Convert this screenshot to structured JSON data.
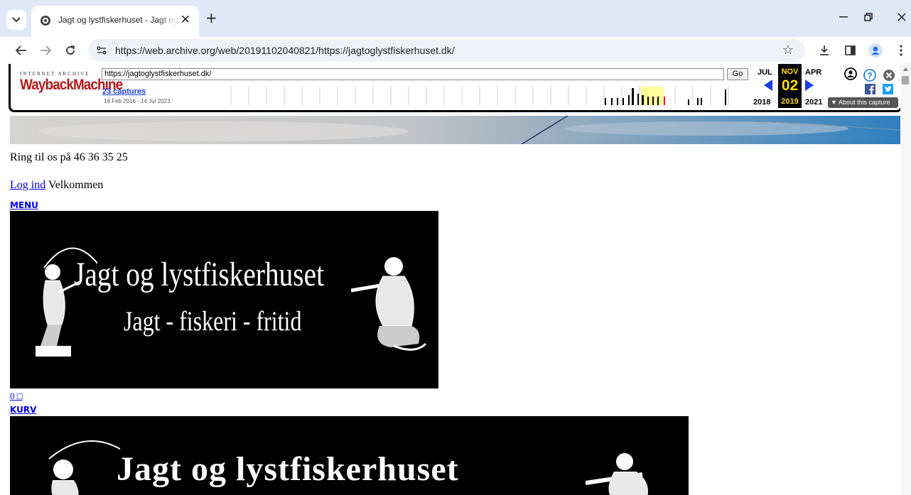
{
  "browser": {
    "tab_title": "Jagt og lystfiskerhuset - Jagt og lystfiskerhuset",
    "url": "https://web.archive.org/web/20191102040821/https://jagtoglystfiskerhuset.dk/"
  },
  "wayback": {
    "ia_label": "INTERNET ARCHIVE",
    "logo_text": "WaybackMachine",
    "url_value": "https://jagtoglystfiskerhuset.dk/",
    "go_label": "Go",
    "captures_label": "23 captures",
    "date_range": "14 Feb 2016 - 14 Jul 2023",
    "prev_month": "JUL",
    "prev_year": "2018",
    "cur_month": "NOV",
    "cur_day": "02",
    "cur_year": "2019",
    "next_month": "APR",
    "next_year": "2021",
    "about_label": "About this capture",
    "colors": {
      "logo_red": "#b4171b",
      "current_yellow": "#ffde00",
      "arrow_blue": "#1a3ee0"
    }
  },
  "page": {
    "phone_text": "Ring til os på 46 36 35 25",
    "login_link": "Log ind",
    "welcome_text": "Velkommen",
    "menu_link": "MENU",
    "cart_count": "0 □",
    "cart_link": "KURV",
    "logo_title": "Jagt og lystfiskerhuset",
    "logo_subtitle": "Jagt - fiskeri - fritid"
  }
}
